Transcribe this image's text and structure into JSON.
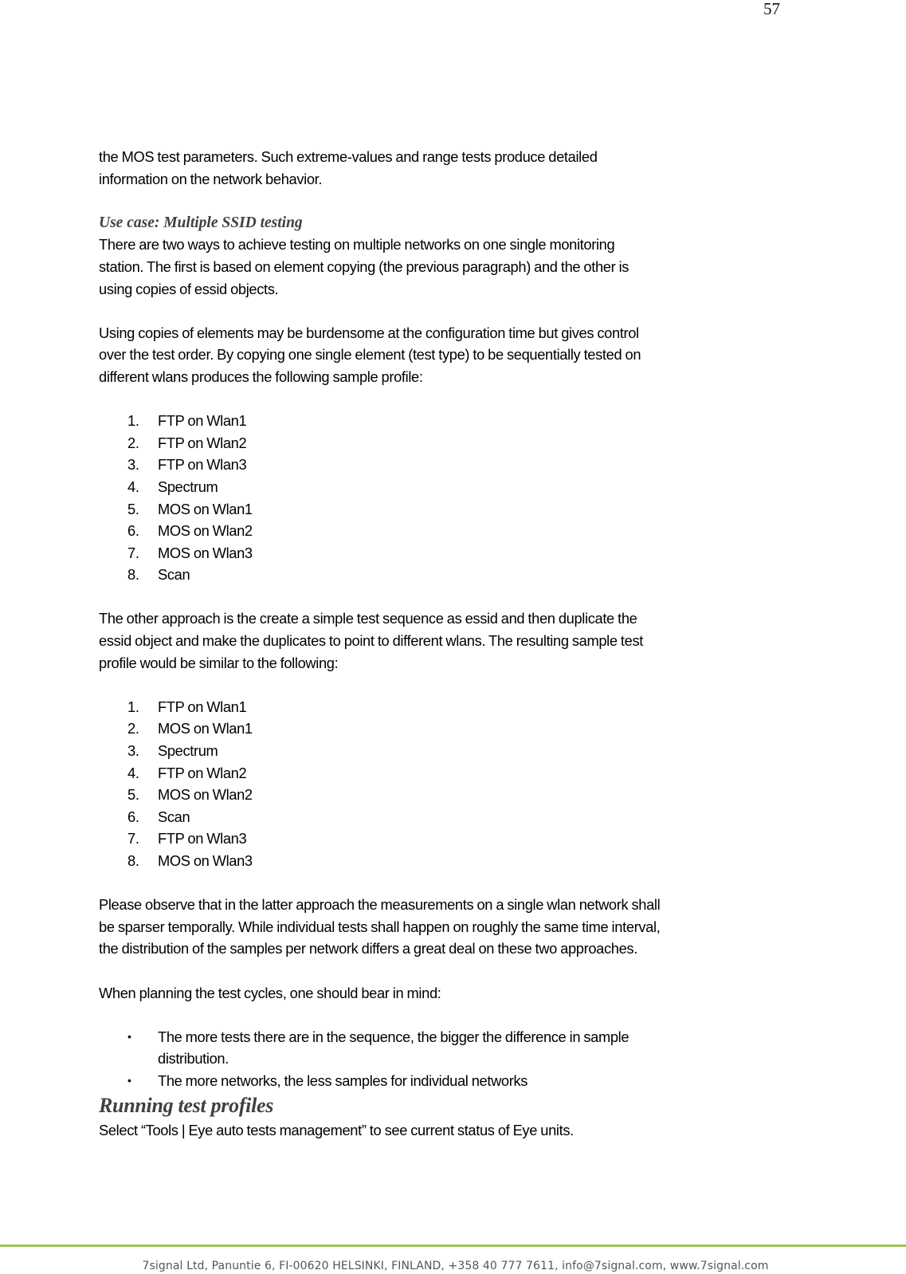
{
  "page": {
    "number": "57"
  },
  "intro": {
    "lines": [
      "the MOS test parameters. Such extreme-values and range tests produce detailed",
      "information on the network behavior."
    ]
  },
  "use_case": {
    "heading": "Use case: Multiple SSID testing",
    "paragraph1": [
      "There are two ways to achieve testing on multiple networks on one single monitoring",
      "station. The first is based on element copying (the previous paragraph) and the other is",
      "using copies of essid objects."
    ],
    "paragraph2": [
      "Using copies of elements may be burdensome at the configuration time but gives control",
      "over the test order. By copying one single element (test type) to be sequentially tested on",
      "different wlans produces the following sample profile:"
    ],
    "list1": [
      {
        "num": "1.",
        "text": "FTP on Wlan1"
      },
      {
        "num": "2.",
        "text": "FTP on Wlan2"
      },
      {
        "num": "3.",
        "text": "FTP on Wlan3"
      },
      {
        "num": "4.",
        "text": "Spectrum"
      },
      {
        "num": "5.",
        "text": "MOS on Wlan1"
      },
      {
        "num": "6.",
        "text": "MOS on Wlan2"
      },
      {
        "num": "7.",
        "text": "MOS on Wlan3"
      },
      {
        "num": "8.",
        "text": "Scan"
      }
    ],
    "paragraph3": [
      "The other approach is the create a simple test sequence as essid and then duplicate the",
      "essid object and make the duplicates to point to different wlans. The resulting sample test",
      "profile would be similar to the following:"
    ],
    "list2": [
      {
        "num": "1.",
        "text": "FTP on Wlan1"
      },
      {
        "num": "2.",
        "text": "MOS on Wlan1"
      },
      {
        "num": "3.",
        "text": "Spectrum"
      },
      {
        "num": "4.",
        "text": "FTP on Wlan2"
      },
      {
        "num": "5.",
        "text": "MOS on Wlan2"
      },
      {
        "num": "6.",
        "text": "Scan"
      },
      {
        "num": "7.",
        "text": "FTP on Wlan3"
      },
      {
        "num": "8.",
        "text": "MOS on Wlan3"
      }
    ],
    "paragraph4": [
      "Please observe that in the latter approach the measurements on a single wlan network shall",
      "be sparser temporally. While individual tests shall happen on roughly the same time interval,",
      "the distribution of the samples per network differs a great deal on these two approaches."
    ],
    "paragraph5": "When planning the test cycles, one should bear in mind:",
    "bullets": [
      {
        "symbol": "•",
        "lines": [
          "The more tests there are in the sequence, the bigger the difference in sample",
          "distribution."
        ]
      },
      {
        "symbol": "•",
        "lines": [
          "The more networks, the less samples for individual networks"
        ]
      }
    ]
  },
  "running": {
    "heading": "Running test profiles",
    "text": "Select “Tools | Eye auto tests management” to see current status of Eye units."
  },
  "footer": {
    "text": "7signal Ltd, Panuntie 6, FI-00620 HELSINKI, FINLAND, +358 40 777 7611, info@7signal.com, www.7signal.com",
    "rule_color": "#9bc45b"
  }
}
